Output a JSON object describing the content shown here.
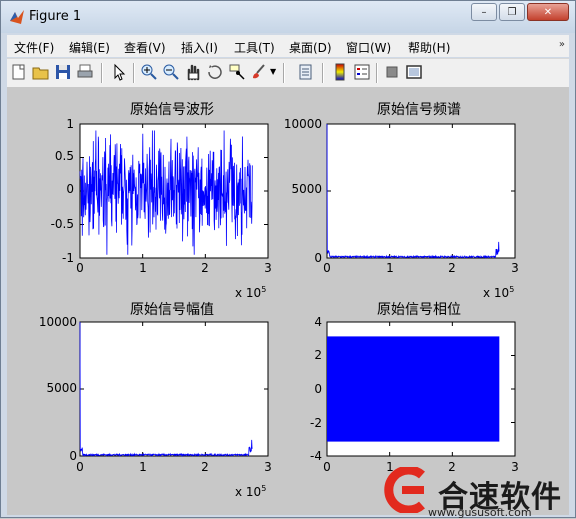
{
  "window": {
    "title": "Figure 1",
    "controls": [
      "minimize",
      "restore",
      "close"
    ]
  },
  "menu": [
    "文件(F)",
    "编辑(E)",
    "查看(V)",
    "插入(I)",
    "工具(T)",
    "桌面(D)",
    "窗口(W)",
    "帮助(H)"
  ],
  "toolbar_icons": [
    "new-figure-icon",
    "open-file-icon",
    "save-icon",
    "print-icon",
    "pointer-icon",
    "zoom-in-icon",
    "zoom-out-icon",
    "pan-hand-icon",
    "rotate-3d-icon",
    "data-cursor-icon",
    "brush-icon",
    "brush-dropdown-icon",
    "link-plot-icon",
    "colorbar-icon",
    "legend-icon",
    "hide-plot-tools-icon",
    "show-plot-tools-icon"
  ],
  "colors": {
    "series": "#0000ff",
    "figure_bg": "#c8c8c8",
    "axes_bg": "#ffffff"
  },
  "chart_data": [
    {
      "type": "line",
      "title": "原始信号波形",
      "xlim": [
        0,
        300000
      ],
      "ylim": [
        -1,
        1
      ],
      "xticks": [
        "0",
        "1",
        "2",
        "3"
      ],
      "yticks": [
        "1",
        "0.5",
        "0",
        "-0.5",
        "-1"
      ],
      "x_multiplier": "x 10^5",
      "series": [
        {
          "x_end": 275000,
          "envelope_max": 0.95,
          "envelope_min": -1.0,
          "character": "waveform"
        }
      ],
      "grid": false
    },
    {
      "type": "line",
      "title": "原始信号频谱",
      "xlim": [
        0,
        300000
      ],
      "ylim": [
        0,
        10000
      ],
      "xticks": [
        "0",
        "1",
        "2",
        "3"
      ],
      "yticks": [
        "10000",
        "5000",
        "0"
      ],
      "x_multiplier": "x 10^5",
      "series": [
        {
          "x_end": 275000,
          "start_peak": 10000,
          "end_peak": 1200,
          "floor": 100,
          "character": "spectrum"
        }
      ],
      "grid": false
    },
    {
      "type": "line",
      "title": "原始信号幅值",
      "xlim": [
        0,
        300000
      ],
      "ylim": [
        0,
        10000
      ],
      "xticks": [
        "0",
        "1",
        "2",
        "3"
      ],
      "yticks": [
        "10000",
        "5000",
        "0"
      ],
      "x_multiplier": "x 10^5",
      "series": [
        {
          "x_end": 275000,
          "start_peak": 10000,
          "end_peak": 1200,
          "floor": 100,
          "character": "spectrum"
        }
      ],
      "grid": false
    },
    {
      "type": "area",
      "title": "原始信号相位",
      "xlim": [
        0,
        300000
      ],
      "ylim": [
        -4,
        4
      ],
      "xticks": [
        "0",
        "1",
        "2",
        "3"
      ],
      "yticks": [
        "4",
        "2",
        "0",
        "-2",
        "-4"
      ],
      "series": [
        {
          "x_end": 275000,
          "y_max": 3.14,
          "y_min": -3.14,
          "character": "phase"
        }
      ],
      "grid": false
    }
  ],
  "watermark": {
    "text": "合速软件",
    "url": "www.gususoft.com"
  }
}
